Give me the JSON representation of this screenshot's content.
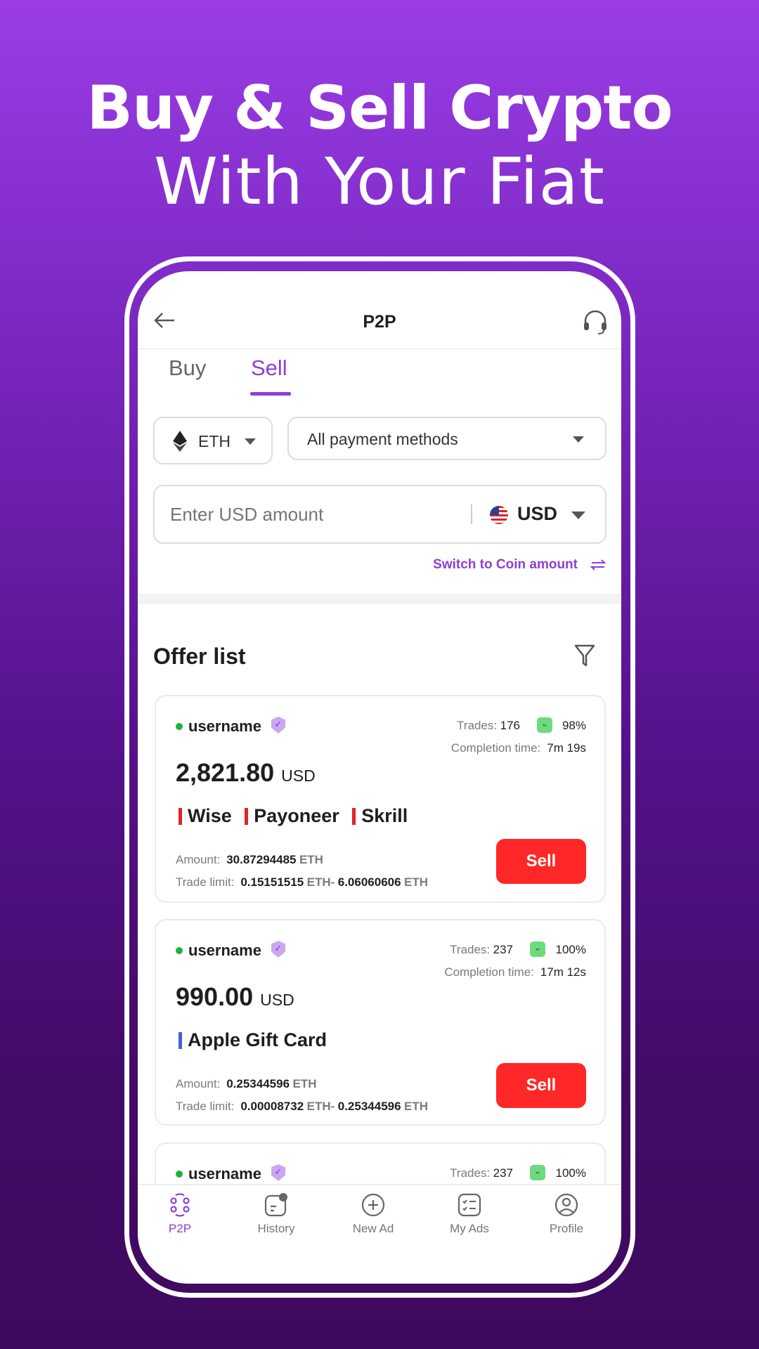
{
  "promo": {
    "headline": "Buy & Sell Crypto",
    "subheadline": "With Your Fiat"
  },
  "header": {
    "title": "P2P",
    "back_icon": "arrow-left-icon",
    "support_icon": "headset-icon"
  },
  "tabs": [
    {
      "label": "Buy",
      "active": false
    },
    {
      "label": "Sell",
      "active": true
    }
  ],
  "filters": {
    "coin": "ETH",
    "payment": "All payment methods",
    "amount_placeholder": "Enter USD amount",
    "currency": "USD",
    "switch_label": "Switch to Coin amount"
  },
  "offers": {
    "title": "Offer list",
    "items": [
      {
        "username": "username",
        "trades_label": "Trades:",
        "trades": "176",
        "rate": "98%",
        "completion_label": "Completion time:",
        "completion": "7m 19s",
        "price": "2,821.80",
        "currency": "USD",
        "methods": [
          {
            "name": "Wise",
            "color": "#e02424"
          },
          {
            "name": "Payoneer",
            "color": "#e02424"
          },
          {
            "name": "Skrill",
            "color": "#e02424"
          }
        ],
        "amount_label": "Amount:",
        "amount": "30.87294485",
        "amount_unit": "ETH",
        "limit_label": "Trade limit:",
        "limit_min": "0.15151515",
        "limit_min_unit": "ETH-",
        "limit_max": "6.06060606",
        "limit_max_unit": "ETH",
        "action": "Sell"
      },
      {
        "username": "username",
        "trades_label": "Trades:",
        "trades": "237",
        "rate": "100%",
        "completion_label": "Completion time:",
        "completion": "17m 12s",
        "price": "990.00",
        "currency": "USD",
        "methods": [
          {
            "name": "Apple Gift Card",
            "color": "#3a63d8"
          }
        ],
        "amount_label": "Amount:",
        "amount": "0.25344596",
        "amount_unit": "ETH",
        "limit_label": "Trade limit:",
        "limit_min": "0.00008732",
        "limit_min_unit": "ETH-",
        "limit_max": "0.25344596",
        "limit_max_unit": "ETH",
        "action": "Sell"
      },
      {
        "username": "username",
        "trades_label": "Trades:",
        "trades": "237",
        "rate": "100%"
      }
    ]
  },
  "nav": [
    {
      "label": "P2P",
      "icon": "p2p-icon",
      "active": true
    },
    {
      "label": "History",
      "icon": "history-icon"
    },
    {
      "label": "New Ad",
      "icon": "plus-circle-icon"
    },
    {
      "label": "My Ads",
      "icon": "checklist-icon"
    },
    {
      "label": "Profile",
      "icon": "user-circle-icon"
    }
  ],
  "colors": {
    "accent": "#8e3fd6",
    "sell": "#ff2727",
    "online": "#18b43a"
  }
}
